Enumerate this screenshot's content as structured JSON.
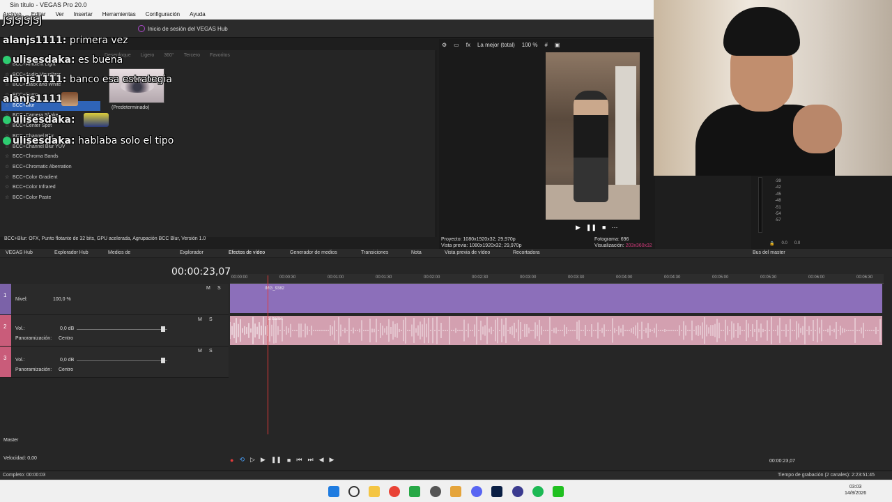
{
  "window": {
    "title": "Sin título - VEGAS Pro 20.0"
  },
  "menu": [
    "Archivo",
    "Editar",
    "Ver",
    "Insertar",
    "Herramientas",
    "Configuración",
    "Ayuda"
  ],
  "toolbar": {
    "hub_login": "Inicio de sesión del VEGAS Hub"
  },
  "chat": [
    {
      "user": "",
      "text": "JSJSJSJSJ"
    },
    {
      "user": "alanjs1111:",
      "text": "primera vez"
    },
    {
      "user": "ulisesdaka:",
      "text": "es buena"
    },
    {
      "user": "alanjs1111:",
      "text": "banco esa estrategia"
    },
    {
      "user": "alanjs1111:",
      "text": ""
    },
    {
      "user": "ulisesdaka:",
      "text": ""
    },
    {
      "user": "ulisesdaka:",
      "text": "hablaba solo el tipo"
    }
  ],
  "effects": {
    "tabs": [
      "Desenfoque",
      "Ligero",
      "360°",
      "Tercero",
      "Favoritos"
    ],
    "items": [
      "BCC+Ambient Light",
      "BCC+Audio Visualizer",
      "BCC+Black and White",
      "BCC+Bump",
      "BCC+Blur",
      "BCC+Camera Shake",
      "BCC+Center Spot",
      "BCC+Channel Blur",
      "BCC+Channel Blur YUV",
      "BCC+Chroma Bands",
      "BCC+Chromatic Aberration",
      "BCC+Color Gradient",
      "BCC+Color Infrared",
      "BCC+Color Paste"
    ],
    "selected_index": 4,
    "thumb_label": "(Predeterminado)",
    "info": "BCC+Blur: OFX, Punto flotante de 32 bits, GPU acelerada, Agrupación BCC Blur, Versión 1.0"
  },
  "preview": {
    "quality": "La mejor (total)",
    "zoom": "100 %",
    "proyecto_label": "Proyecto:",
    "proyecto": "1080x1920x32; 29,970p",
    "vista_label": "Vista previa:",
    "vista": "1080x1920x32; 29,970p",
    "fotograma_label": "Fotograma:",
    "fotograma": "696",
    "visualizacion_label": "Visualización:",
    "visualizacion": "203x360x32"
  },
  "meter": {
    "labels": [
      "-39",
      "-42",
      "-45",
      "-48",
      "-51",
      "-54",
      "-57"
    ],
    "left": "0.0",
    "right": "0.0"
  },
  "dock_tabs": [
    "VEGAS Hub",
    "Explorador Hub",
    "Medios de proyecto",
    "Explorador",
    "Efectos de vídeo",
    "Generador de medios",
    "Transiciones",
    "Nota",
    "Vista previa de vídeo",
    "Recortadora",
    "Bus del master"
  ],
  "timeline": {
    "timecode": "00:00:23,07",
    "ruler": [
      "00:00:00",
      "00:00:30",
      "00:01:00",
      "00:01:30",
      "00:02:00",
      "00:02:30",
      "00:03:00",
      "00:03:30",
      "00:04:00",
      "00:04:30",
      "00:05:00",
      "00:05:30",
      "00:06:00",
      "00:06:30"
    ],
    "tracks": [
      {
        "num": "1",
        "label": "Nivel:",
        "value": "100,0 %"
      },
      {
        "num": "2",
        "label": "Vol.:",
        "value": "0,0 dB",
        "pan_label": "Panoramización:",
        "pan": "Centro"
      },
      {
        "num": "3",
        "label": "Vol.:",
        "value": "0,0 dB",
        "pan_label": "Panoramización:",
        "pan": "Centro"
      }
    ],
    "video_clip": "IMG_9382",
    "audio_clip": "el bailes",
    "master_label": "Master",
    "speed_label": "Velocidad: 0,00",
    "end_timecode": "00:00:23,07",
    "playhead_fraction": 0.018
  },
  "status": {
    "left": "Completo: 00:00:03",
    "right": "Tiempo de grabación (2 canales): 2:23:51:45"
  },
  "clock": {
    "time": "03:03",
    "date": "14/8/2026"
  }
}
